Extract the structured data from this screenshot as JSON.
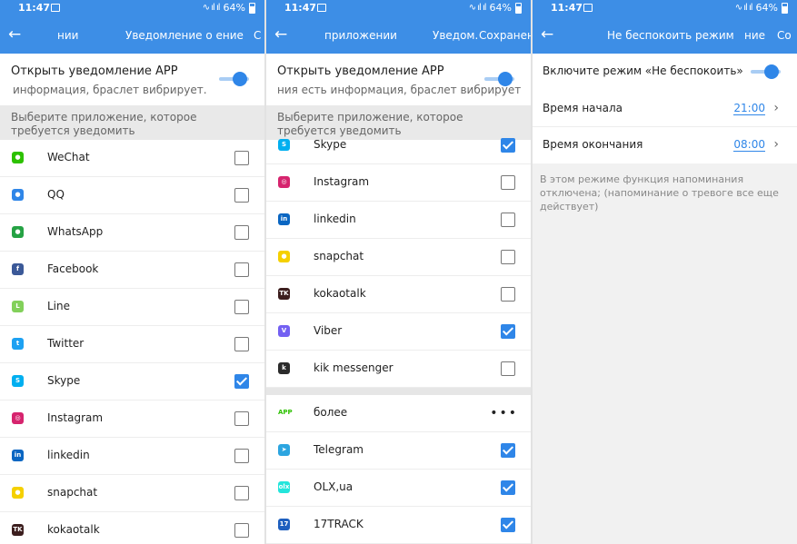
{
  "status": {
    "time": "11:47",
    "battery": "64%",
    "signal": "∿ ıl ıl"
  },
  "panel1": {
    "back_icon": "←",
    "title_left": "нии",
    "title_right": "Уведомление о  ение",
    "title_edge": "С",
    "notify_title": "Открыть уведомление APP",
    "notify_sub": "информация, браслет вибрирует.",
    "notify_toggle": "on",
    "section": "Выберите приложение, которое требуется уведомить",
    "apps": [
      {
        "name": "WeChat",
        "icon": "wechat-icon",
        "color": "#2dc100",
        "glyph": "●",
        "checked": false
      },
      {
        "name": "QQ",
        "icon": "qq-icon",
        "color": "#2f86e8",
        "glyph": "●",
        "checked": false
      },
      {
        "name": "WhatsApp",
        "icon": "whatsapp-icon",
        "color": "#25a244",
        "glyph": "●",
        "checked": false
      },
      {
        "name": "Facebook",
        "icon": "facebook-icon",
        "color": "#3b5998",
        "glyph": "f",
        "checked": false
      },
      {
        "name": "Line",
        "icon": "line-icon",
        "color": "#82d05a",
        "glyph": "L",
        "checked": false
      },
      {
        "name": "Twitter",
        "icon": "twitter-icon",
        "color": "#1da1f2",
        "glyph": "t",
        "checked": false
      },
      {
        "name": "Skype",
        "icon": "skype-icon",
        "color": "#00aff0",
        "glyph": "S",
        "checked": true
      },
      {
        "name": "Instagram",
        "icon": "instagram-icon",
        "color": "#d6246e",
        "glyph": "◎",
        "checked": false
      },
      {
        "name": "linkedin",
        "icon": "linkedin-icon",
        "color": "#0a66c2",
        "glyph": "in",
        "checked": false
      },
      {
        "name": "snapchat",
        "icon": "snapchat-icon",
        "color": "#f5d000",
        "glyph": "●",
        "checked": false
      },
      {
        "name": "kokaotalk",
        "icon": "kakaotalk-icon",
        "color": "#3c1e1e",
        "glyph": "TK",
        "checked": false
      }
    ]
  },
  "panel2": {
    "back_icon": "←",
    "title_left": "приложении",
    "title_mid": "Уведом.",
    "title_right": "Сохранен",
    "notify_title": "Открыть уведомление APP",
    "notify_sub": "ния есть информация, браслет вибрирует",
    "notify_toggle": "on",
    "section": "Выберите приложение, которое требуется уведомить",
    "apps": [
      {
        "name": "Skype",
        "icon": "skype-icon",
        "color": "#00aff0",
        "glyph": "S",
        "checked": true
      },
      {
        "name": "Instagram",
        "icon": "instagram-icon",
        "color": "#d6246e",
        "glyph": "◎",
        "checked": false
      },
      {
        "name": "linkedin",
        "icon": "linkedin-icon",
        "color": "#0a66c2",
        "glyph": "in",
        "checked": false
      },
      {
        "name": "snapchat",
        "icon": "snapchat-icon",
        "color": "#f5d000",
        "glyph": "●",
        "checked": false
      },
      {
        "name": "kokaotalk",
        "icon": "kakaotalk-icon",
        "color": "#3c1e1e",
        "glyph": "TK",
        "checked": false
      },
      {
        "name": "Viber",
        "icon": "viber-icon",
        "color": "#7360f2",
        "glyph": "V",
        "checked": true
      },
      {
        "name": "kik messenger",
        "icon": "kik-icon",
        "color": "#2b2b2b",
        "glyph": "k",
        "checked": false
      }
    ],
    "more": {
      "name": "более",
      "icon": "app-more-icon",
      "badge": "APP",
      "dots": "•••"
    },
    "apps_extra": [
      {
        "name": "Telegram",
        "icon": "telegram-icon",
        "color": "#2ca5e0",
        "glyph": "➤",
        "checked": true
      },
      {
        "name": "OLX,ua",
        "icon": "olx-icon",
        "color": "#23e5db",
        "glyph": "olx",
        "checked": true
      },
      {
        "name": "17TRACK",
        "icon": "17track-icon",
        "color": "#1e5fbf",
        "glyph": "17",
        "checked": true
      }
    ]
  },
  "panel3": {
    "back_icon": "←",
    "title": "Не беспокоить режим",
    "title_right": "ние",
    "title_edge": "Со",
    "dnd_label": "Включите режим «Не беспокоить»",
    "dnd_toggle": "on",
    "start_label": "Время начала",
    "start_value": "21:00",
    "end_label": "Время окончания",
    "end_value": "08:00",
    "chevron": "›",
    "note": "В этом режиме функция напоминания отключена; (напоминание о тревоге все еще действует)"
  },
  "colors": {
    "accent": "#3d8ee6",
    "checkbox_on": "#2f86e8",
    "section_bg": "#e9e9e9"
  }
}
